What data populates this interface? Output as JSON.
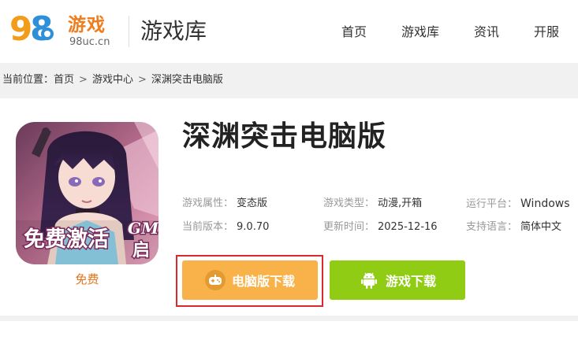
{
  "header": {
    "logo_digits_9": "9",
    "logo_digits_8": "8",
    "logo_text": "游戏",
    "logo_url": "98uc.cn",
    "title": "游戏库",
    "nav": [
      "首页",
      "游戏库",
      "资讯",
      "开服"
    ]
  },
  "breadcrumb": {
    "prefix": "当前位置：",
    "items": [
      "首页",
      "游戏中心",
      "深渊突击电脑版"
    ],
    "separator": ">"
  },
  "game": {
    "title": "深渊突击电脑版",
    "icon_badge_text": "免费激活",
    "icon_badge_gm": "GM",
    "icon_badge_start": "启",
    "price": "免费",
    "meta": {
      "attr_label": "游戏属性：",
      "attr_value": "变态版",
      "type_label": "游戏类型：",
      "type_value": "动漫,开箱",
      "platform_label": "运行平台：",
      "platform_value": "Windows",
      "version_label": "当前版本：",
      "version_value": "9.0.70",
      "updated_label": "更新时间：",
      "updated_value": "2025-12-16",
      "lang_label": "支持语言：",
      "lang_value": "简体中文"
    },
    "buttons": {
      "pc_download": "电脑版下载",
      "game_download": "游戏下载"
    }
  },
  "colors": {
    "accent_orange": "#f9b14a",
    "accent_green": "#8fcc13",
    "highlight_red": "#d9282e",
    "price_orange": "#e0741a"
  }
}
